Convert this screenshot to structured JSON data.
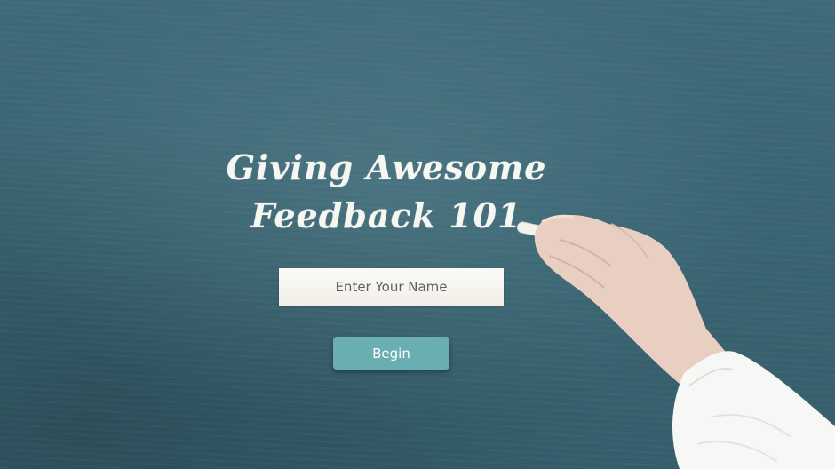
{
  "title": {
    "line1": "Giving Awesome",
    "line2": "Feedback 101"
  },
  "name_input": {
    "placeholder": "Enter Your Name",
    "value": ""
  },
  "begin_button": {
    "label": "Begin"
  },
  "colors": {
    "chalkboard": "#3a6573",
    "chalk_text": "#f7f7f2",
    "button_accent": "#6aaeb1",
    "input_background": "#f7f5ef"
  }
}
